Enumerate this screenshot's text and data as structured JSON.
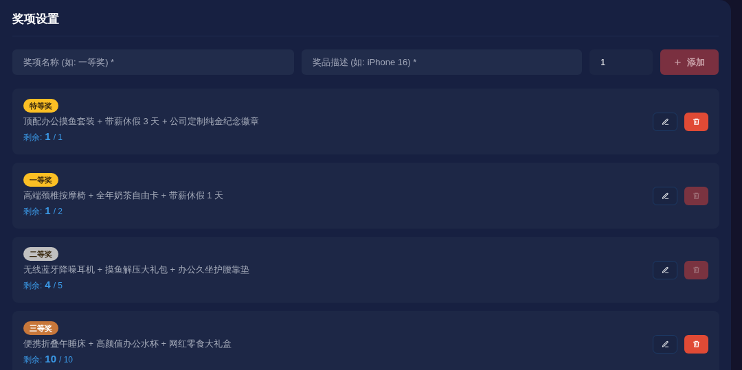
{
  "title": "奖项设置",
  "form": {
    "name_placeholder": "奖项名称 (如: 一等奖) *",
    "desc_placeholder": "奖品描述 (如: iPhone 16) *",
    "count_value": "1",
    "add_icon": "+",
    "add_label": "添加",
    "add_disabled": true
  },
  "prizes": [
    {
      "badge": "特等奖",
      "color": "#fbbf24",
      "description": "顶配办公摸鱼套装 + 带薪休假 3 天 + 公司定制纯金纪念徽章",
      "remaining_label": "剩余:",
      "remaining": "1",
      "total": "/ 1",
      "delete_disabled": false
    },
    {
      "badge": "一等奖",
      "color": "#fbbf24",
      "description": "高端颈椎按摩椅 + 全年奶茶自由卡 + 带薪休假 1 天",
      "remaining_label": "剩余:",
      "remaining": "1",
      "total": "/ 2",
      "delete_disabled": true
    },
    {
      "badge": "二等奖",
      "color": "#c0c0c0",
      "description": "无线蓝牙降噪耳机 + 摸鱼解压大礼包 + 办公久坐护腰靠垫",
      "remaining_label": "剩余:",
      "remaining": "4",
      "total": "/ 5",
      "delete_disabled": true
    },
    {
      "badge": "三等奖",
      "color": "#c8773a",
      "description": "便携折叠午睡床 + 高颜值办公水杯 + 网红零食大礼盒",
      "remaining_label": "剩余:",
      "remaining": "10",
      "total": "/ 10",
      "delete_disabled": false
    }
  ]
}
